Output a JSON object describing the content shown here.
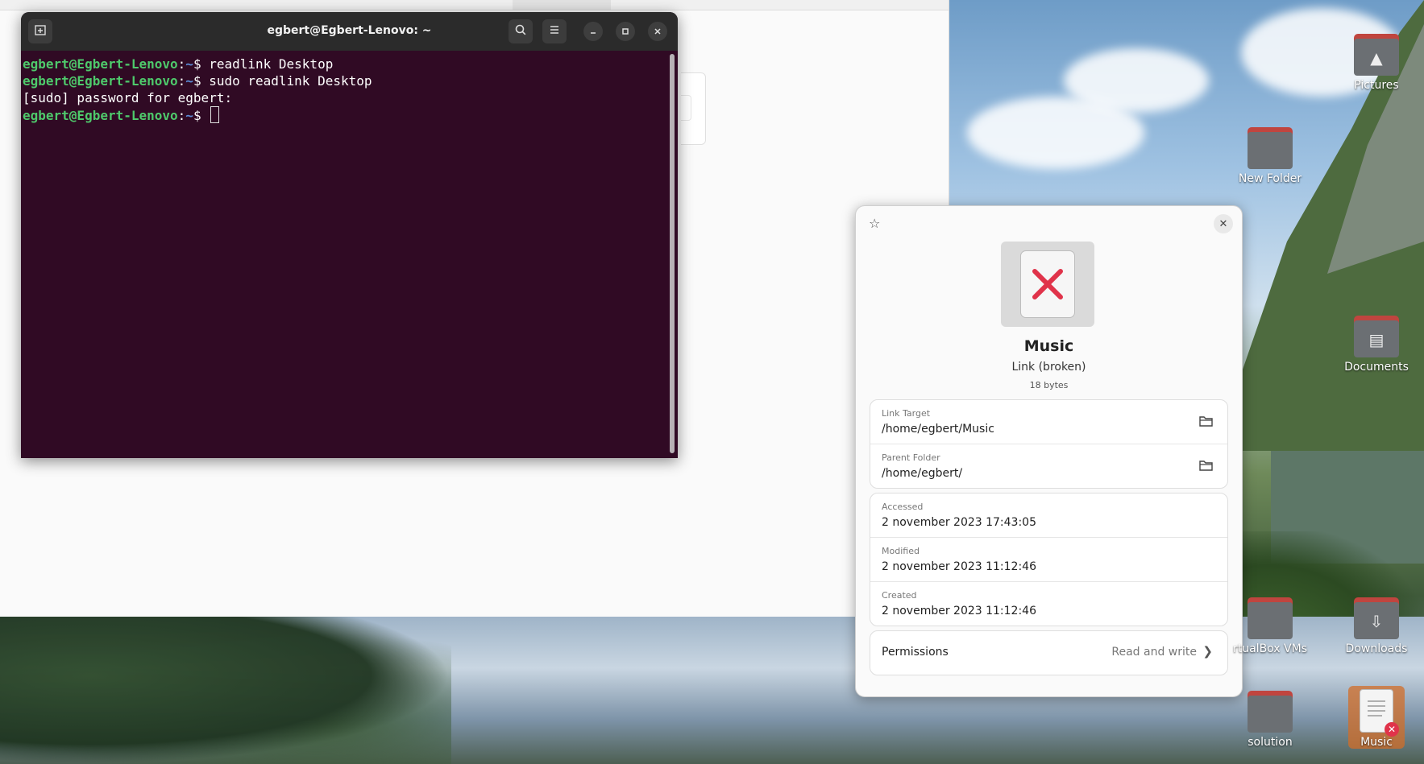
{
  "terminal": {
    "title": "egbert@Egbert-Lenovo: ~",
    "lines": [
      {
        "user": "egbert@Egbert-Lenovo",
        "sep": ":",
        "path": "~",
        "prompt": "$ ",
        "cmd": "readlink Desktop"
      },
      {
        "user": "egbert@Egbert-Lenovo",
        "sep": ":",
        "path": "~",
        "prompt": "$ ",
        "cmd": "sudo readlink Desktop"
      },
      {
        "plain": "[sudo] password for egbert:"
      },
      {
        "user": "egbert@Egbert-Lenovo",
        "sep": ":",
        "path": "~",
        "prompt": "$ ",
        "cmd": ""
      }
    ],
    "buttons": {
      "new_tab": "new-tab-icon",
      "search": "search-icon",
      "menu": "hamburger-menu-icon",
      "minimize": "minimize-icon",
      "maximize": "maximize-icon",
      "close": "close-icon"
    }
  },
  "properties": {
    "name": "Music",
    "type": "Link (broken)",
    "size": "18 bytes",
    "link_target_label": "Link Target",
    "link_target": "/home/egbert/Music",
    "parent_folder_label": "Parent Folder",
    "parent_folder": "/home/egbert/",
    "accessed_label": "Accessed",
    "accessed": "2 november 2023 17:43:05",
    "modified_label": "Modified",
    "modified": "2 november 2023 11:12:46",
    "created_label": "Created",
    "created": "2 november 2023 11:12:46",
    "permissions_label": "Permissions",
    "permissions_value": "Read and write"
  },
  "desktop": {
    "icons": [
      {
        "label": "Pictures",
        "icon": "pictures-folder-icon"
      },
      {
        "label": "New Folder",
        "icon": "folder-icon"
      },
      {
        "label": "Documents",
        "icon": "documents-folder-icon"
      },
      {
        "label": "rtualBox VMs",
        "icon": "folder-icon"
      },
      {
        "label": "Downloads",
        "icon": "downloads-folder-icon"
      },
      {
        "label": "solution",
        "icon": "folder-icon"
      },
      {
        "label": "Music",
        "icon": "broken-link-file-icon"
      }
    ]
  },
  "colors": {
    "terminal_bg": "#300a24",
    "prompt_user": "#4ec96b",
    "prompt_path": "#5b8bd6",
    "broken_x": "#e0334a",
    "folder_tab": "#c0453f"
  }
}
